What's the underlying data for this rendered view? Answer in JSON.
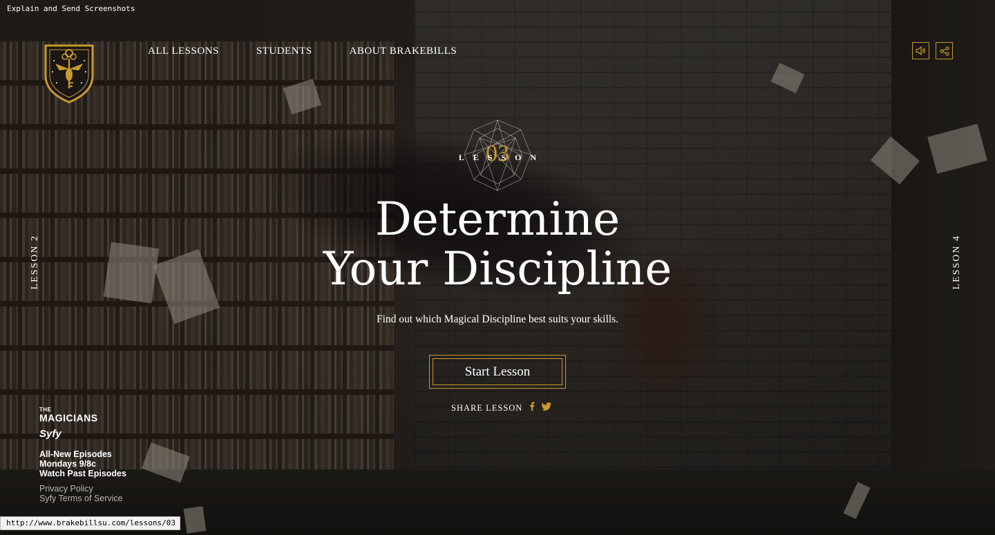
{
  "helper_text": "Explain and Send Screenshots",
  "status_url": "http://www.brakebillsu.com/lessons/03",
  "nav": {
    "items": [
      "ALL LESSONS",
      "STUDENTS",
      "ABOUT BRAKEBILLS"
    ]
  },
  "icons": {
    "sound": "speaker-icon",
    "share": "share-icon",
    "facebook": "facebook-icon",
    "twitter": "twitter-icon"
  },
  "side_nav": {
    "prev": "LESSON 2",
    "next": "LESSON 4"
  },
  "lesson": {
    "label": "LESSON",
    "number": "03",
    "title_line1": "Determine",
    "title_line2": "Your Discipline",
    "subtitle": "Find out which Magical Discipline best suits your skills.",
    "start_label": "Start Lesson",
    "share_label": "SHARE LESSON"
  },
  "footer": {
    "show_the": "THE",
    "show_name": "MAGICIANS",
    "network": "Syfy",
    "promo": [
      "All-New Episodes",
      "Mondays 9/8c",
      "Watch Past Episodes"
    ],
    "legal": [
      "Privacy Policy",
      "Syfy Terms of Service"
    ]
  },
  "colors": {
    "accent": "#c99a2e",
    "text": "#ffffff"
  }
}
